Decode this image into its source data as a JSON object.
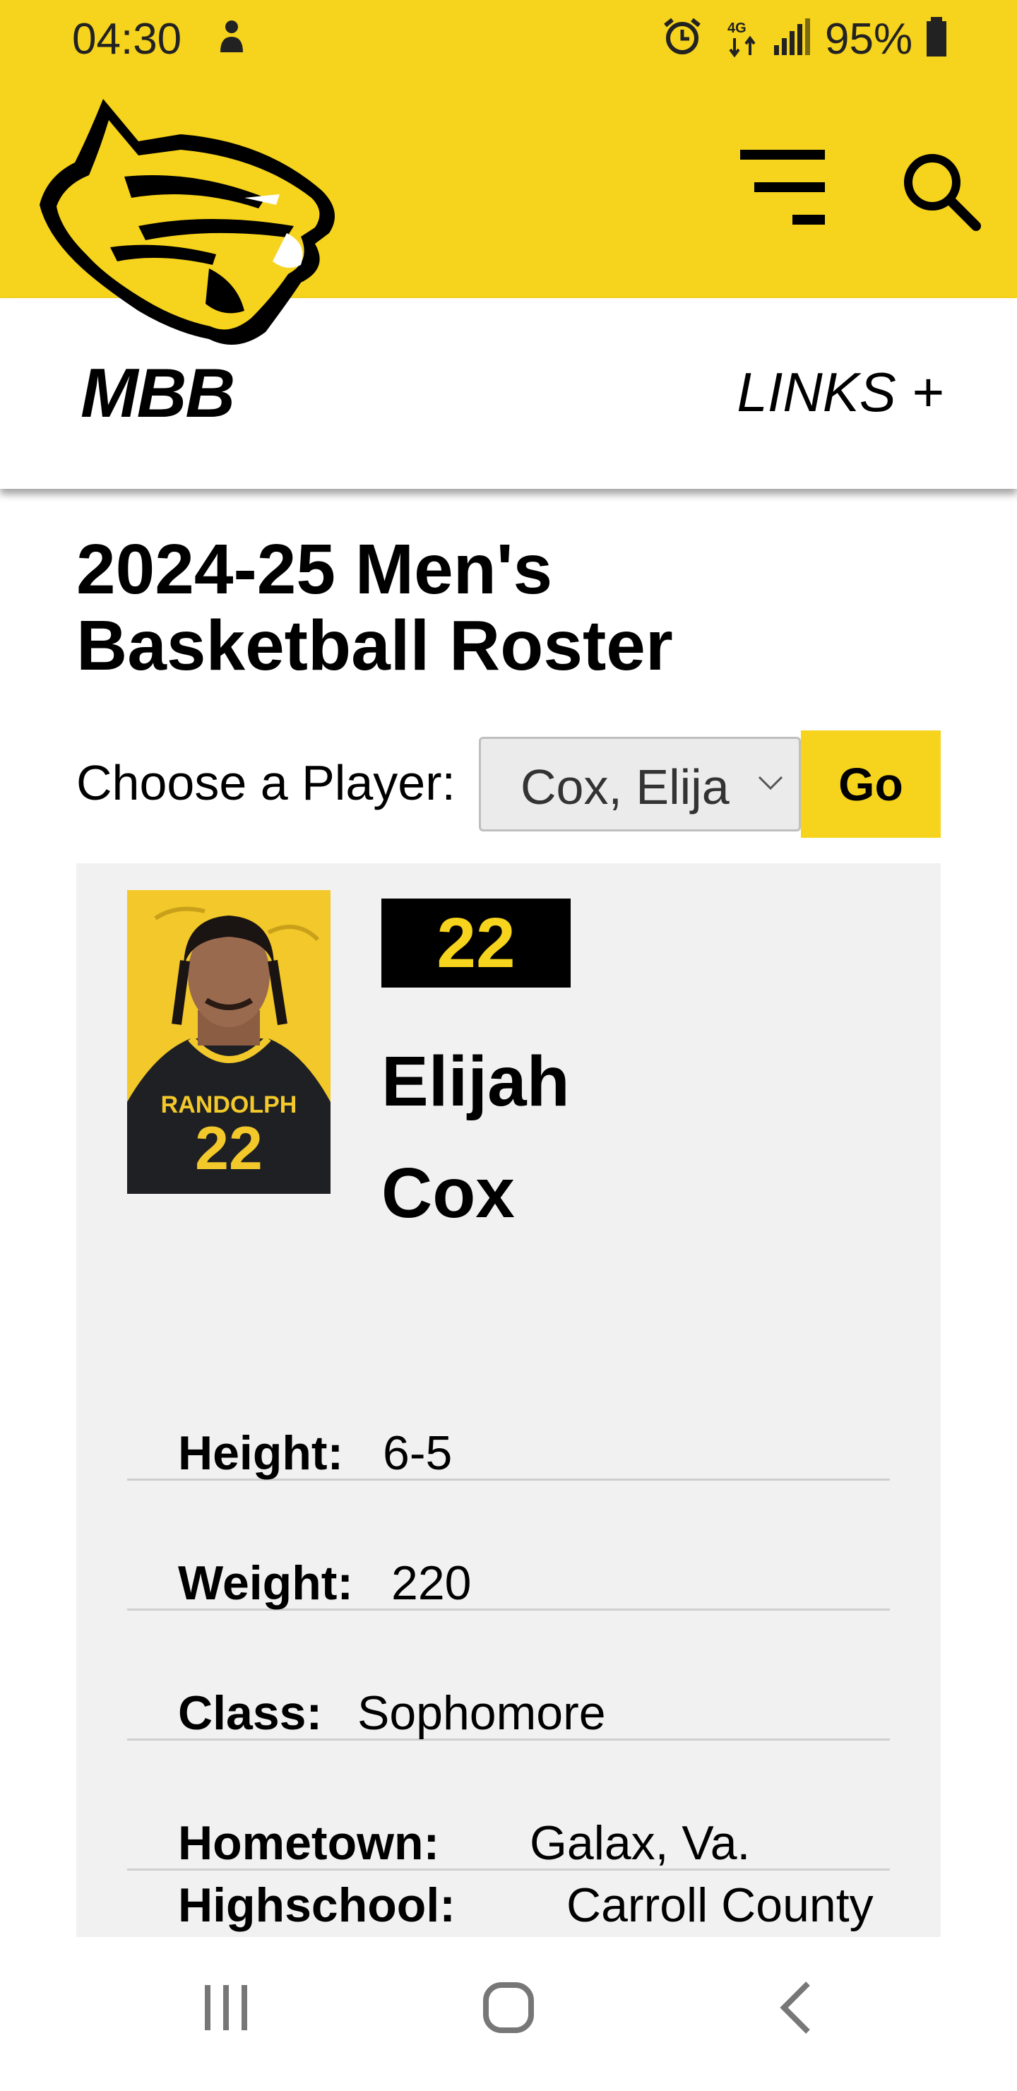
{
  "status_bar": {
    "time": "04:30",
    "battery": "95%",
    "icons": [
      "person-icon",
      "alarm-icon",
      "data-4g-lte-icon",
      "signal-icon",
      "battery-icon"
    ]
  },
  "header": {
    "logo_alt": "wildcat-logo",
    "section": "MBB",
    "links_label": "LINKS +",
    "accent_color": "#F6D31C"
  },
  "page": {
    "title": "2024-25 Men's Basketball Roster"
  },
  "chooser": {
    "label": "Choose a Player:",
    "selected": "Cox, Elija",
    "go_label": "Go"
  },
  "player": {
    "number": "22",
    "first_name": "Elijah",
    "last_name": "Cox",
    "jersey_text": "RANDOLPH",
    "details": [
      {
        "label": "Height:",
        "value": "6-5"
      },
      {
        "label": "Weight:",
        "value": "220"
      },
      {
        "label": "Class:",
        "value": "Sophomore"
      },
      {
        "label": "Hometown:",
        "value": "Galax, Va."
      },
      {
        "label": "Highschool:",
        "value": "Carroll County"
      }
    ]
  },
  "nav": {
    "icons": [
      "recent-apps-icon",
      "home-icon",
      "back-icon"
    ]
  }
}
